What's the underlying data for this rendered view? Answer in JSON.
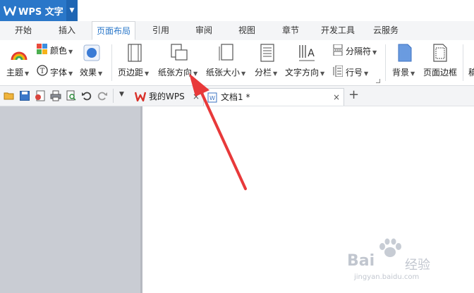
{
  "app": {
    "title": "WPS 文字",
    "brand_color": "#2a77c9"
  },
  "menu_tabs": [
    {
      "label": "开始"
    },
    {
      "label": "插入"
    },
    {
      "label": "页面布局"
    },
    {
      "label": "引用"
    },
    {
      "label": "审阅"
    },
    {
      "label": "视图"
    },
    {
      "label": "章节"
    },
    {
      "label": "开发工具"
    },
    {
      "label": "云服务"
    }
  ],
  "active_tab": "页面布局",
  "ribbon": {
    "theme": "主题",
    "color": "颜色",
    "font": "字体",
    "effect": "效果",
    "margins": "页边距",
    "orientation": "纸张方向",
    "size": "纸张大小",
    "columns": "分栏",
    "text_direction": "文字方向",
    "breaks": "分隔符",
    "line_numbers": "行号",
    "background": "背景",
    "page_border": "页面边框",
    "more": "稿"
  },
  "doc_tabs": [
    {
      "label": "我的WPS"
    },
    {
      "label": "文档1 *"
    }
  ],
  "new_tab_symbol": "+",
  "close_symbol": "×",
  "watermark": {
    "brand": "Bai",
    "brand2": "经验",
    "url": "jingyan.baidu.com"
  },
  "annotation": {
    "arrow_color": "#e8393a"
  }
}
